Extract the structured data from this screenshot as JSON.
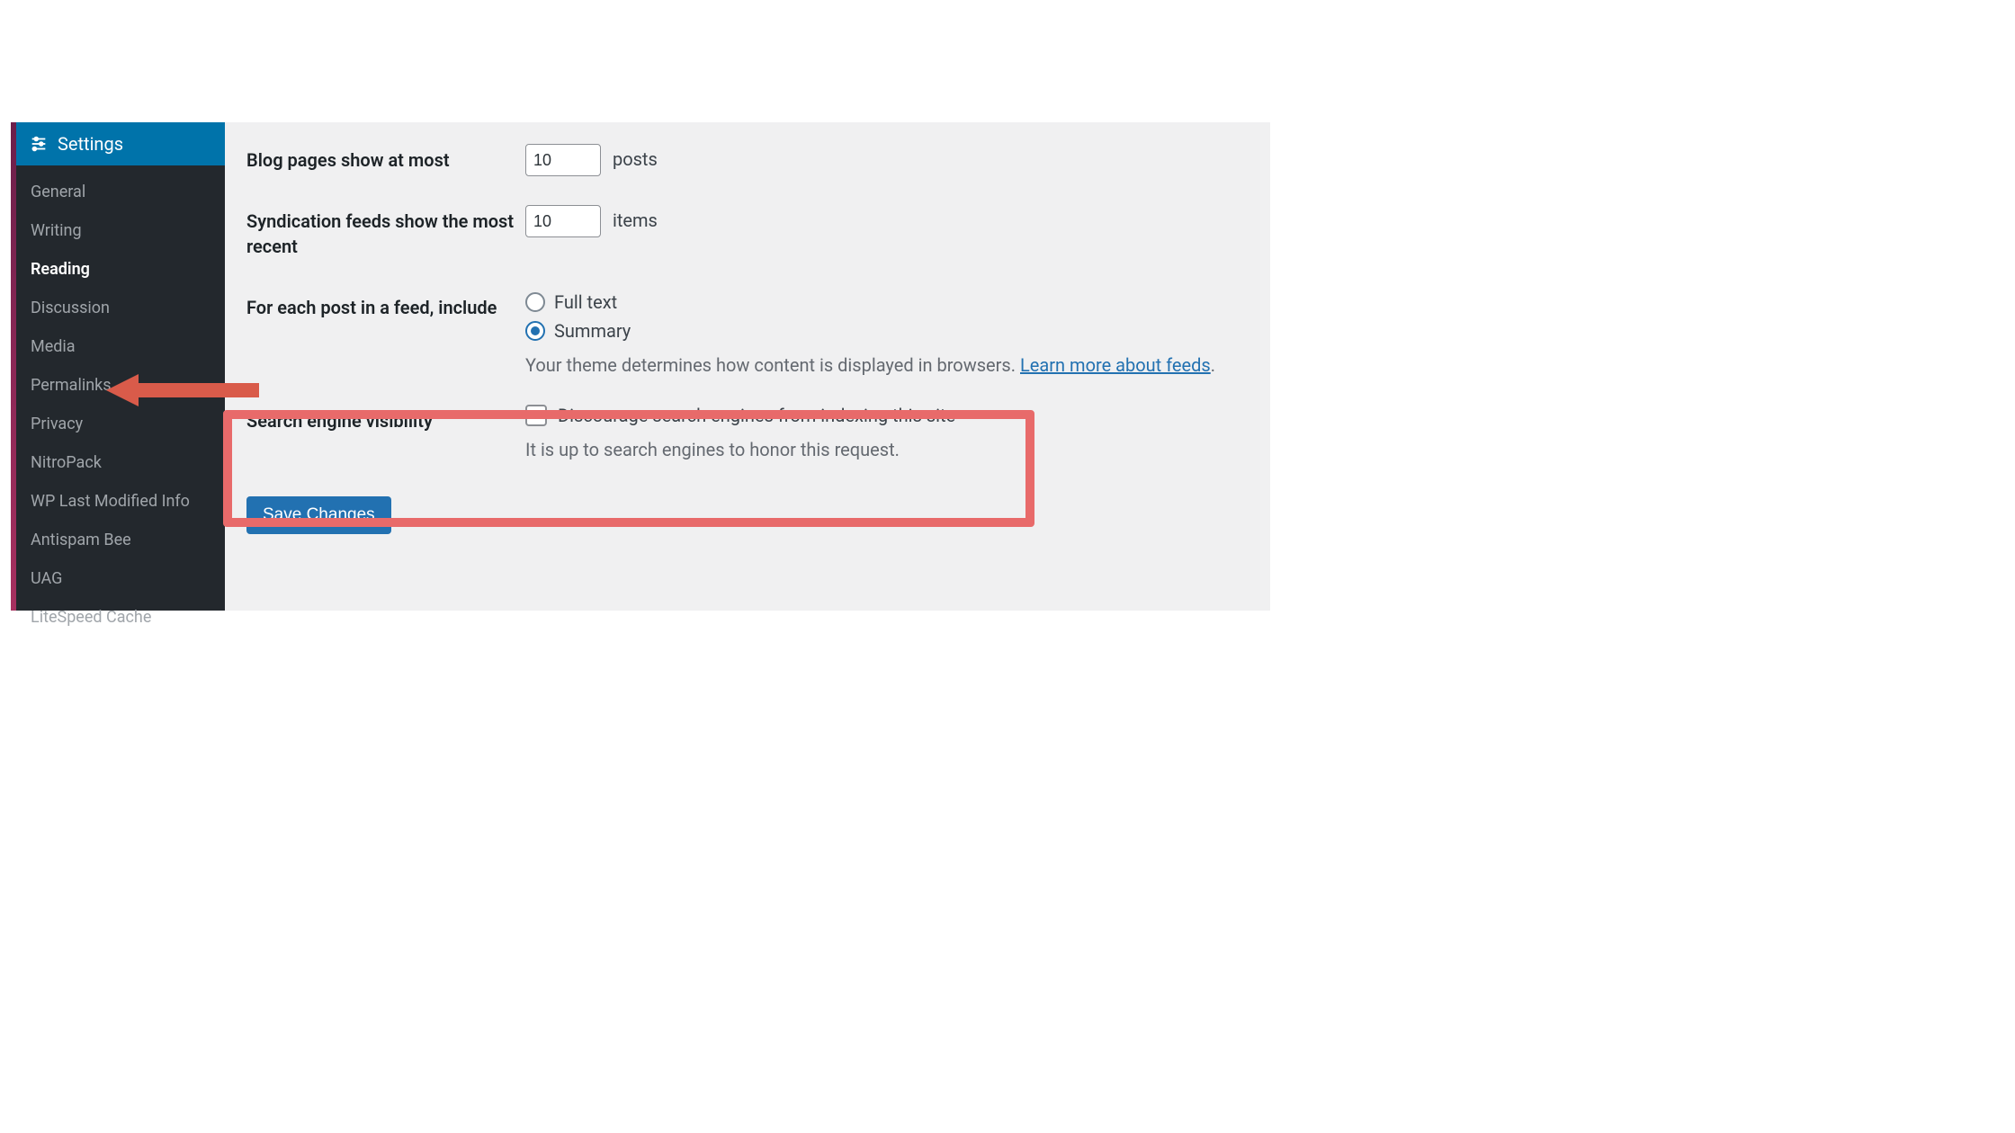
{
  "sidebar": {
    "header_label": "Settings",
    "items": [
      {
        "label": "General",
        "active": false
      },
      {
        "label": "Writing",
        "active": false
      },
      {
        "label": "Reading",
        "active": true
      },
      {
        "label": "Discussion",
        "active": false
      },
      {
        "label": "Media",
        "active": false
      },
      {
        "label": "Permalinks",
        "active": false
      },
      {
        "label": "Privacy",
        "active": false
      },
      {
        "label": "NitroPack",
        "active": false
      },
      {
        "label": "WP Last Modified Info",
        "active": false
      },
      {
        "label": "Antispam Bee",
        "active": false
      },
      {
        "label": "UAG",
        "active": false
      },
      {
        "label": "LiteSpeed Cache",
        "active": false
      }
    ]
  },
  "settings": {
    "blog_pages_label": "Blog pages show at most",
    "blog_pages_value": "10",
    "blog_pages_suffix": "posts",
    "syndication_label": "Syndication feeds show the most recent",
    "syndication_value": "10",
    "syndication_suffix": "items",
    "feed_include_label": "For each post in a feed, include",
    "feed_full_text_label": "Full text",
    "feed_summary_label": "Summary",
    "feed_selected": "summary",
    "feed_description_prefix": "Your theme determines how content is displayed in browsers. ",
    "feed_description_link": "Learn more about feeds",
    "feed_description_period": ".",
    "search_visibility_label": "Search engine visibility",
    "search_visibility_checkbox_label": "Discourage search engines from indexing this site",
    "search_visibility_note": "It is up to search engines to honor this request.",
    "save_button_label": "Save Changes"
  },
  "colors": {
    "accent": "#2271b1",
    "sidebar_bg": "#23282d",
    "header_bg": "#0073aa",
    "highlight_border": "#e86a6a",
    "arrow_fill": "#d95b4a"
  }
}
